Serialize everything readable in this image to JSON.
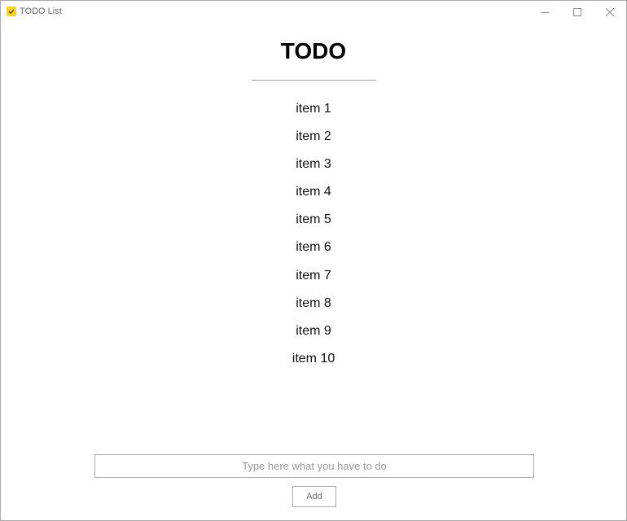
{
  "window": {
    "title": "TODO List",
    "icon": "checkmark-icon",
    "controls": [
      "minimize-icon",
      "maximize-icon",
      "close-icon"
    ]
  },
  "main": {
    "title": "TODO",
    "items": [
      {
        "label": "item 1"
      },
      {
        "label": "item 2"
      },
      {
        "label": "item 3"
      },
      {
        "label": "item 4"
      },
      {
        "label": "item 5"
      },
      {
        "label": "item 6"
      },
      {
        "label": "item 7"
      },
      {
        "label": "item 8"
      },
      {
        "label": "item 9"
      },
      {
        "label": "item 10"
      }
    ]
  },
  "form": {
    "input_value": "",
    "input_placeholder": "Type here what you have to do",
    "add_label": "Add"
  },
  "colors": {
    "icon_accent": "#f5d327",
    "border": "#a9a9a9",
    "placeholder": "#9a9a9a"
  }
}
